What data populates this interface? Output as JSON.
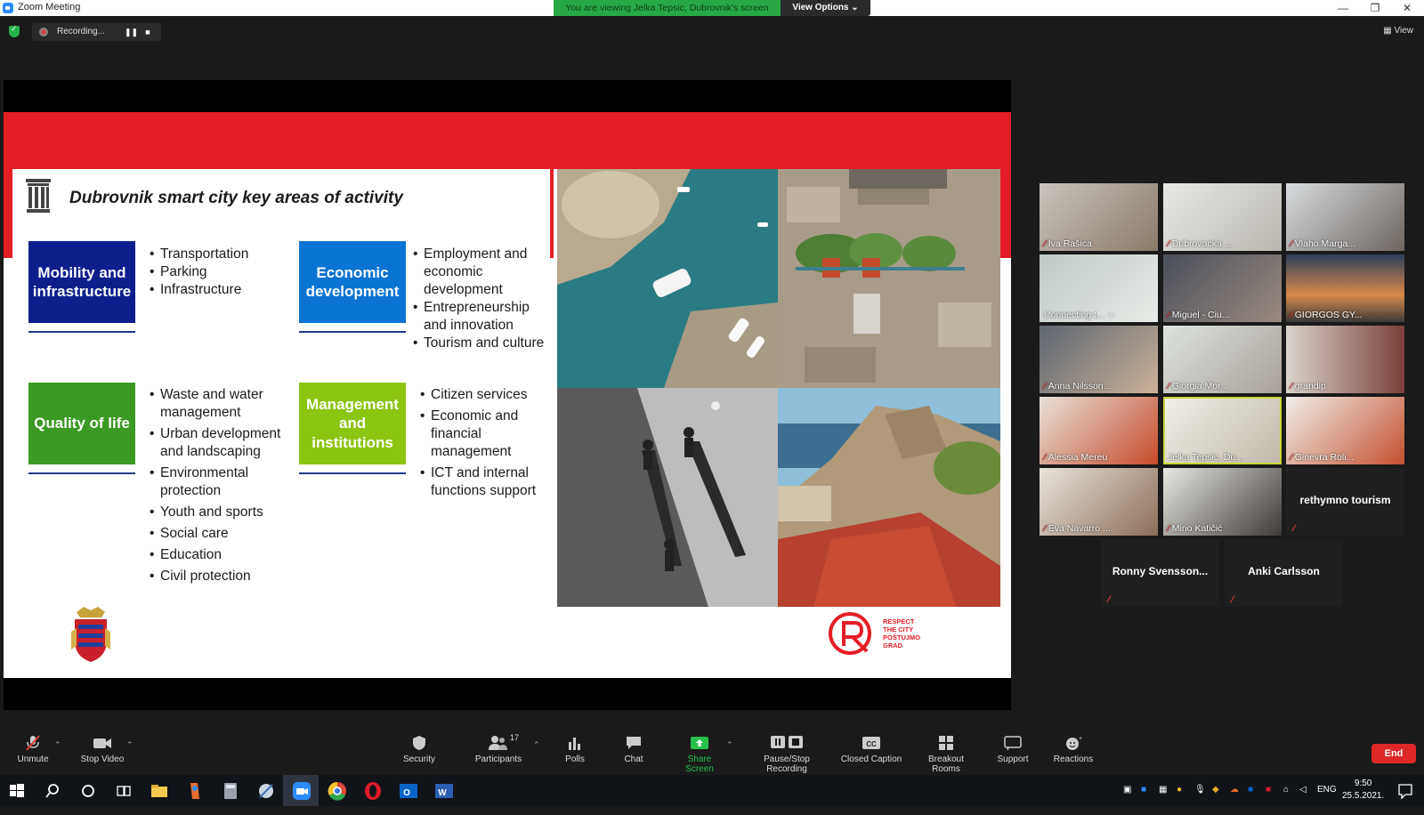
{
  "window": {
    "title": "Zoom Meeting",
    "share_banner": "You are viewing Jelka Tepsic, Dubrovnik's screen",
    "view_options": "View Options ⌄",
    "minimize": "—",
    "restore": "❐",
    "close": "✕"
  },
  "recording": {
    "label": "Recording...",
    "pause": "❚❚",
    "stop": "■"
  },
  "view_button": "View",
  "slide": {
    "title": "Dubrovnik smart city key areas of activity",
    "areas": [
      {
        "label": "Mobility and infrastructure",
        "color": "#0d1e8c",
        "items": [
          "Transportation",
          "Parking",
          "Infrastructure"
        ]
      },
      {
        "label": "Economic development",
        "color": "#0a74d4",
        "items": [
          "Employment and economic development",
          "Entrepreneurship and innovation",
          "Tourism and culture"
        ]
      },
      {
        "label": "Quality of life",
        "color": "#3a9a23",
        "items": [
          "Waste and water management",
          "Urban development and landscaping",
          "Environmental protection",
          "Youth and sports",
          "Social care",
          "Education",
          "Civil protection"
        ]
      },
      {
        "label": "Management and institutions",
        "color": "#8cc412",
        "items": [
          "Citizen services",
          "Economic and financial management",
          "ICT and internal functions support"
        ]
      }
    ],
    "logo_text": [
      "RESPECT",
      "THE CITY",
      "POŠTUJMO",
      "GRAD"
    ],
    "accent_color": "#e41e26"
  },
  "participants": [
    {
      "name": "Iva Rašica",
      "muted": true
    },
    {
      "name": "Dubrovacka ...",
      "muted": true
    },
    {
      "name": "Vlaho Marga...",
      "muted": true
    },
    {
      "name": "Connecting t...",
      "muted": false
    },
    {
      "name": "Miguel - Ciu...",
      "muted": true
    },
    {
      "name": "GIORGOS GY...",
      "muted": true
    },
    {
      "name": "Anna Nilsson...",
      "muted": true
    },
    {
      "name": "Giorgia Mor...",
      "muted": true
    },
    {
      "name": "grandip",
      "muted": true
    },
    {
      "name": "Alessia Mereu",
      "muted": true
    },
    {
      "name": "Jelka Tepsic, Du...",
      "muted": false,
      "active_speaker": true
    },
    {
      "name": "Ginevra Roli...",
      "muted": true
    },
    {
      "name": "Eva Navarro ...",
      "muted": true
    },
    {
      "name": "Mino Katičić",
      "muted": true
    },
    {
      "name": "rethymno tourism",
      "muted": true,
      "video": false
    },
    {
      "name": "Ronny  Svensson...",
      "muted": true,
      "video": false
    },
    {
      "name": "Anki Carlsson",
      "muted": true,
      "video": false
    }
  ],
  "toolbar": {
    "unmute": "Unmute",
    "stop_video": "Stop Video",
    "security": "Security",
    "participants": "Participants",
    "participants_count": "17",
    "polls": "Polls",
    "chat": "Chat",
    "share_screen": "Share Screen",
    "pause_stop_recording": "Pause/Stop Recording",
    "closed_caption": "Closed Caption",
    "breakout_rooms": "Breakout Rooms",
    "support": "Support",
    "reactions": "Reactions",
    "end": "End"
  },
  "taskbar": {
    "language": "ENG",
    "time": "9:50",
    "date": "25.5.2021."
  }
}
